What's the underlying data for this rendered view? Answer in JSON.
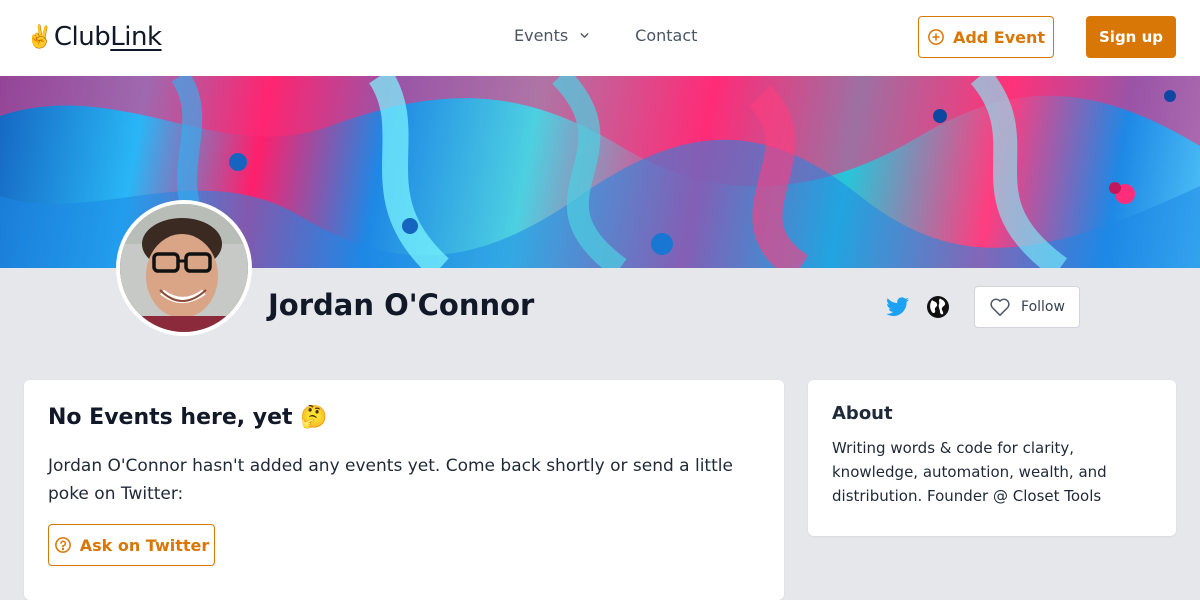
{
  "header": {
    "logo_prefix": "Club",
    "logo_suffix": "Link",
    "logo_emoji": "✌️",
    "nav": {
      "events_label": "Events",
      "contact_label": "Contact"
    },
    "add_event_label": "Add Event",
    "sign_up_label": "Sign up"
  },
  "profile": {
    "name": "Jordan O'Connor",
    "follow_label": "Follow",
    "social_icons": [
      "twitter-icon",
      "globe-icon"
    ]
  },
  "events_card": {
    "title": "No Events here, yet 🤔",
    "message": "Jordan O'Connor hasn't added any events yet. Come back shortly or send a little poke on Twitter:",
    "ask_button_label": "Ask on Twitter"
  },
  "about_card": {
    "title": "About",
    "description": "Writing words & code for clarity, knowledge, automation, wealth, and distribution. Founder @ Closet Tools"
  },
  "colors": {
    "accent": "#d97706",
    "twitter": "#1da1f2",
    "page_bg": "#e5e7eb"
  }
}
